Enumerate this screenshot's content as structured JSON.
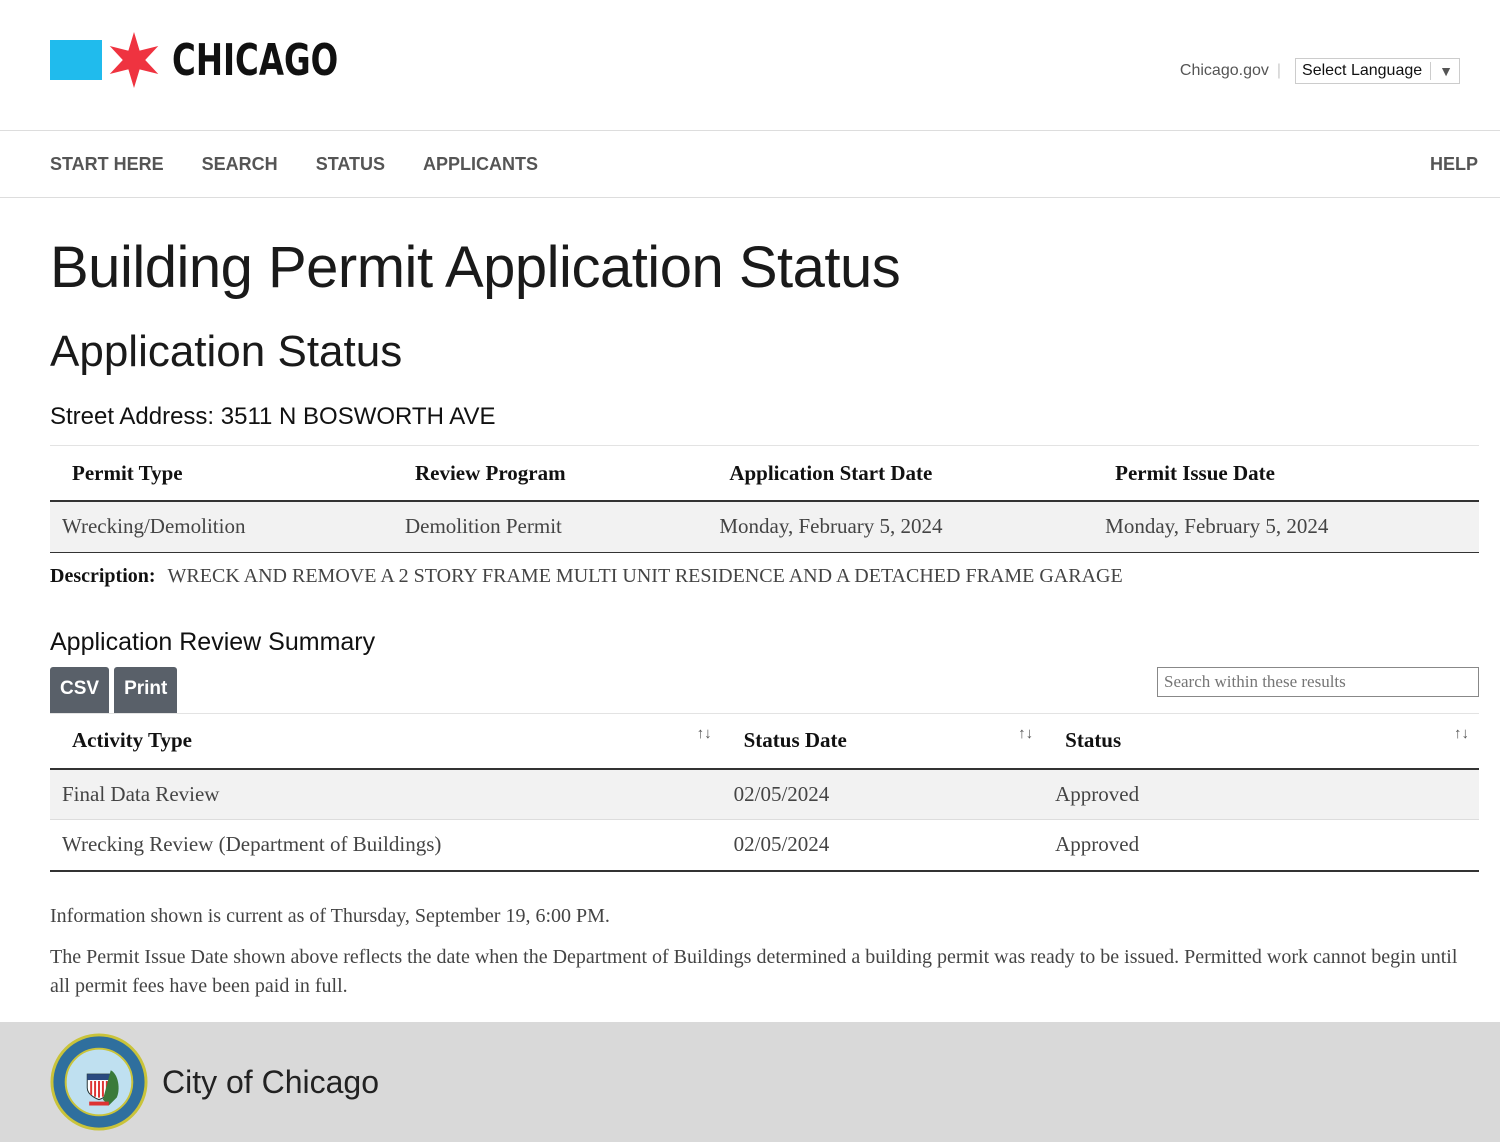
{
  "header": {
    "logo_text": "CHICAGO",
    "gov_link": "Chicago.gov",
    "language_select": "Select Language"
  },
  "nav": {
    "items": [
      "START HERE",
      "SEARCH",
      "STATUS",
      "APPLICANTS"
    ],
    "help": "HELP"
  },
  "page": {
    "title": "Building Permit Application Status",
    "subtitle": "Application Status",
    "street_address": "Street Address: 3511 N BOSWORTH AVE"
  },
  "permit_table": {
    "headers": [
      "Permit Type",
      "Review Program",
      "Application Start Date",
      "Permit Issue Date"
    ],
    "row": [
      "Wrecking/Demolition",
      "Demolition Permit",
      "Monday, February 5, 2024",
      "Monday, February 5, 2024"
    ]
  },
  "description": {
    "label": "Description:",
    "text": "WRECK AND REMOVE A 2 STORY FRAME MULTI UNIT RESIDENCE AND A DETACHED FRAME GARAGE"
  },
  "review": {
    "title": "Application Review Summary",
    "csv": "CSV",
    "print": "Print",
    "search_placeholder": "Search within these results",
    "headers": [
      "Activity Type",
      "Status Date",
      "Status"
    ],
    "sort_icon": "↑↓",
    "rows": [
      [
        "Final Data Review",
        "02/05/2024",
        "Approved"
      ],
      [
        "Wrecking Review (Department of Buildings)",
        "02/05/2024",
        "Approved"
      ]
    ]
  },
  "notes": [
    "Information shown is current as of Thursday, September 19, 6:00 PM.",
    "The Permit Issue Date shown above reflects the date when the Department of Buildings determined a building permit was ready to be issued. Permitted work cannot begin until all permit fees have been paid in full."
  ],
  "footer": {
    "name": "City of Chicago",
    "seal_text": "CITY OF CHICAGO INCORPORATED 4th MARCH 1837"
  },
  "colors": {
    "logo_blue": "#20bbed",
    "star_red": "#ef3340",
    "button": "#596069",
    "footer_bg": "#d9d9d9"
  }
}
